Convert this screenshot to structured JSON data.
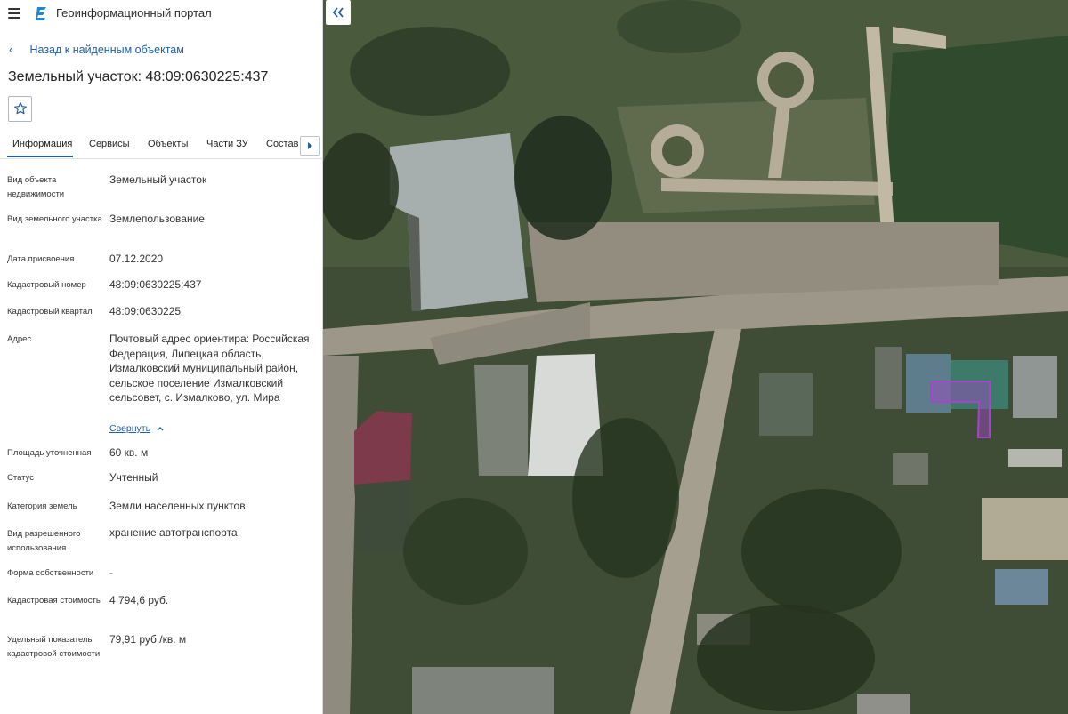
{
  "header": {
    "app_title": "Геоинформационный портал",
    "menu_icon": "hamburger-icon",
    "logo_icon": "portal-logo-icon"
  },
  "nav": {
    "back_label": "Назад к найденным объектам"
  },
  "object": {
    "title": "Земельный участок: 48:09:0630225:437"
  },
  "tabs": [
    {
      "label": "Информация",
      "active": true
    },
    {
      "label": "Сервисы"
    },
    {
      "label": "Объекты"
    },
    {
      "label": "Части ЗУ"
    },
    {
      "label": "Состав"
    }
  ],
  "details": [
    {
      "label": "Вид объекта недвижимости",
      "value": "Земельный участок"
    },
    {
      "label": "Вид земельного участка",
      "value": "Землепользование"
    },
    {
      "label": "Дата присвоения",
      "value": "07.12.2020"
    },
    {
      "label": "Кадастровый номер",
      "value": "48:09:0630225:437"
    },
    {
      "label": "Кадастровый квартал",
      "value": "48:09:0630225"
    },
    {
      "label": "Адрес",
      "value": "Почтовый адрес ориентира: Российская Федерация, Липецкая область, Измалковский муниципальный район, сельское поселение Измалковский сельсовет, с. Измалково, ул. Мира"
    },
    {
      "label": "Площадь уточненная",
      "value": "60 кв. м"
    },
    {
      "label": "Статус",
      "value": "Учтенный"
    },
    {
      "label": "Категория земель",
      "value": "Земли населенных пунктов"
    },
    {
      "label": "Вид разрешенного использования",
      "value": "хранение автотранспорта"
    },
    {
      "label": "Форма собственности",
      "value": "-"
    },
    {
      "label": "Кадастровая стоимость",
      "value": "4 794,6 руб."
    },
    {
      "label": "Удельный показатель кадастровой стоимости",
      "value": "79,91 руб./кв. м"
    }
  ],
  "address_toggle": "Свернуть",
  "map": {
    "collapse_icon": "double-chevron-left-icon",
    "parcel_color": "#a347c9"
  }
}
